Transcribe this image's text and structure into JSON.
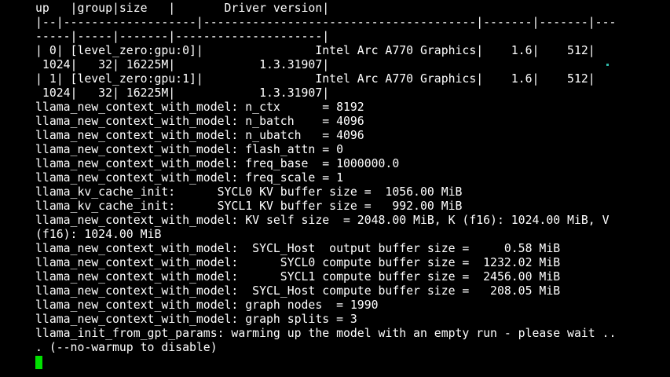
{
  "terminal": {
    "lines": [
      "up   |group|size   |       Driver version|",
      "|--|-------------------|---------------------------------------|-------|-------|---",
      "-----|-----|-------|---------------------|",
      "| 0| [level_zero:gpu:0]|                Intel Arc A770 Graphics|    1.6|    512|",
      " 1024|   32| 16225M|            1.3.31907|",
      "| 1| [level_zero:gpu:1]|                Intel Arc A770 Graphics|    1.6|    512|",
      " 1024|   32| 16225M|            1.3.31907|",
      "llama_new_context_with_model: n_ctx      = 8192",
      "llama_new_context_with_model: n_batch    = 4096",
      "llama_new_context_with_model: n_ubatch   = 4096",
      "llama_new_context_with_model: flash_attn = 0",
      "llama_new_context_with_model: freq_base  = 1000000.0",
      "llama_new_context_with_model: freq_scale = 1",
      "llama_kv_cache_init:      SYCL0 KV buffer size =  1056.00 MiB",
      "llama_kv_cache_init:      SYCL1 KV buffer size =   992.00 MiB",
      "llama_new_context_with_model: KV self size  = 2048.00 MiB, K (f16): 1024.00 MiB, V",
      "(f16): 1024.00 MiB",
      "llama_new_context_with_model:  SYCL_Host  output buffer size =     0.58 MiB",
      "llama_new_context_with_model:      SYCL0 compute buffer size =  1232.02 MiB",
      "llama_new_context_with_model:      SYCL1 compute buffer size =  2456.00 MiB",
      "llama_new_context_with_model:  SYCL_Host compute buffer size =   208.05 MiB",
      "llama_new_context_with_model: graph nodes  = 1990",
      "llama_new_context_with_model: graph splits = 3",
      "llama_init_from_gpt_params: warming up the model with an empty run - please wait ..",
      ". (--no-warmup to disable)"
    ],
    "colors": {
      "background": "#000000",
      "foreground": "#ffffff",
      "cursor": "#00e000"
    }
  }
}
